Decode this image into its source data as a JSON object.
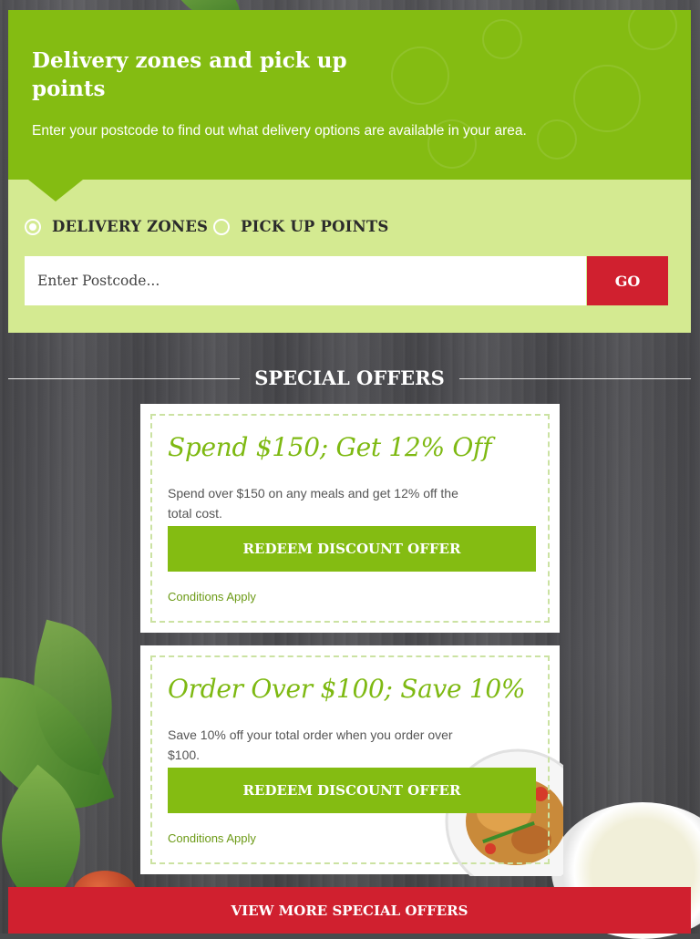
{
  "delivery": {
    "title": "Delivery zones and pick up points",
    "description": "Enter your postcode to find out what delivery options are available in your area.",
    "options": [
      {
        "label": "DELIVERY ZONES",
        "checked": true
      },
      {
        "label": "PICK UP POINTS",
        "checked": false
      }
    ],
    "postcode_placeholder": "Enter Postcode...",
    "go_label": "GO"
  },
  "offers": {
    "heading": "SPECIAL OFFERS",
    "cards": [
      {
        "title": "Spend $150; Get 12% Off",
        "text": "Spend over $150 on any meals and get 12% off the total cost.",
        "button": "REDEEM DISCOUNT OFFER",
        "conditions": "Conditions Apply"
      },
      {
        "title": "Order Over $100; Save 10%",
        "text": "Save 10% off your total order when you order over $100.",
        "button": "REDEEM DISCOUNT OFFER",
        "conditions": "Conditions Apply"
      }
    ],
    "more_button": "VIEW MORE SPECIAL OFFERS"
  },
  "colors": {
    "accent_green": "#84bc12",
    "light_green": "#d4ea91",
    "accent_red": "#d0202f"
  }
}
